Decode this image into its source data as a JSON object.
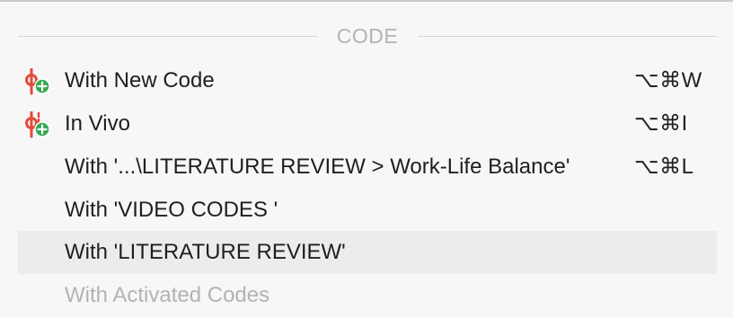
{
  "colors": {
    "code_icon_red": "#e24a3b",
    "plus_badge_green": "#35a853",
    "disabled_text": "#b3b3b3",
    "highlight_row": "#ececec"
  },
  "menu": {
    "section_title": "CODE",
    "items": [
      {
        "label": "With New Code",
        "shortcut": "⌥⌘W",
        "icon": "code-add-icon"
      },
      {
        "label": "In Vivo",
        "shortcut": "⌥⌘I",
        "icon": "in-vivo-code-icon"
      },
      {
        "label": "With '...\\LITERATURE REVIEW > Work-Life Balance'",
        "shortcut": "⌥⌘L"
      },
      {
        "label": "With 'VIDEO CODES '"
      },
      {
        "label": "With 'LITERATURE REVIEW'",
        "state": "highlighted"
      },
      {
        "label": "With Activated Codes",
        "state": "disabled"
      }
    ]
  }
}
